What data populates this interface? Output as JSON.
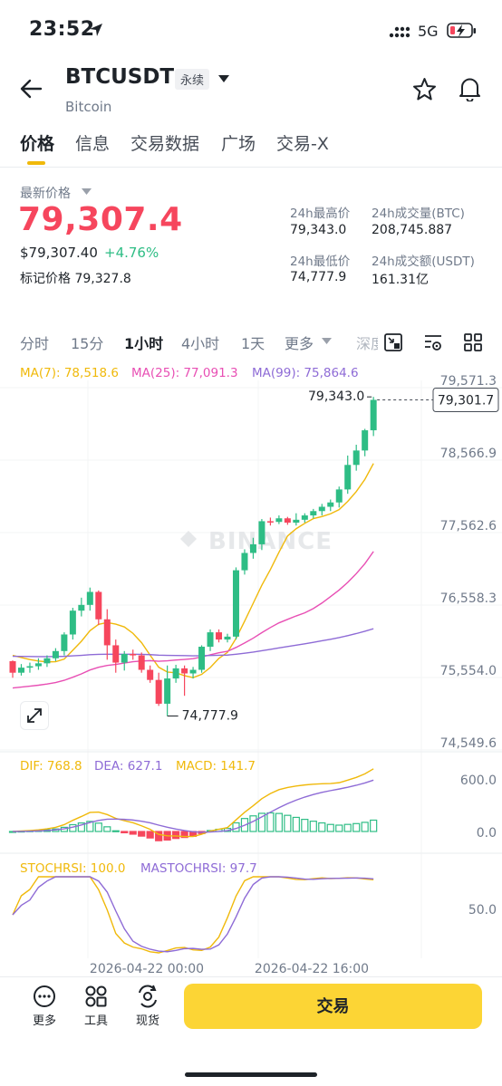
{
  "status_bar": {
    "time": "23:52",
    "network": "5G"
  },
  "header": {
    "symbol": "BTCUSDT",
    "contract_type": "永续",
    "name": "Bitcoin"
  },
  "tabs": [
    {
      "label": "价格",
      "active": true
    },
    {
      "label": "信息"
    },
    {
      "label": "交易数据"
    },
    {
      "label": "广场"
    },
    {
      "label": "交易-X"
    }
  ],
  "price": {
    "latest_label": "最新价格",
    "last": "79,307.4",
    "usd": "$79,307.40",
    "change": "+4.76%",
    "mark_label": "标记价格",
    "mark": "79,327.8"
  },
  "stats": {
    "high_label": "24h最高价",
    "high": "79,343.0",
    "low_label": "24h最低价",
    "low": "74,777.9",
    "vol_btc_label": "24h成交量(BTC)",
    "vol_btc": "208,745.887",
    "vol_usdt_label": "24h成交额(USDT)",
    "vol_usdt": "161.31亿"
  },
  "intervals": [
    {
      "label": "分时"
    },
    {
      "label": "15分"
    },
    {
      "label": "1小时",
      "active": true
    },
    {
      "label": "4小时"
    },
    {
      "label": "1天"
    },
    {
      "label": "更多"
    },
    {
      "label": "深度"
    }
  ],
  "indicators": {
    "ma7": "MA(7): 78,518.6",
    "ma25": "MA(25): 77,091.3",
    "ma99": "MA(99): 75,864.6",
    "dif": "DIF: 768.8",
    "dea": "DEA: 627.1",
    "macd": "MACD: 141.7",
    "stochrsi": "STOCHRSI: 100.0",
    "mastochrsi": "MASTOCHRSI: 97.7"
  },
  "chart_data": {
    "type": "candlestick",
    "price_ticks": [
      "79,571.3",
      "78,566.9",
      "77,562.6",
      "76,558.3",
      "75,554.0",
      "74,549.6"
    ],
    "current_price_tag": "79,301.7",
    "high_marker": "79,343.0",
    "low_marker": "74,777.9",
    "x_labels": [
      "2026-04-22 00:00",
      "2026-04-22 16:00"
    ],
    "macd_ticks": [
      "600.0",
      "0.0"
    ],
    "stoch_ticks": [
      "50.0"
    ],
    "watermark": "BINANCE",
    "colors": {
      "up": "#2ebd85",
      "down": "#f6465d",
      "ma7": "#f0b90b",
      "ma25": "#e84fb4",
      "ma99": "#8e6bd6"
    },
    "candles": [
      [
        75680,
        75690,
        75450,
        75520
      ],
      [
        75520,
        75640,
        75480,
        75590
      ],
      [
        75590,
        75660,
        75520,
        75610
      ],
      [
        75610,
        75720,
        75560,
        75650
      ],
      [
        75650,
        75760,
        75600,
        75720
      ],
      [
        75720,
        75860,
        75680,
        75820
      ],
      [
        75820,
        76080,
        75760,
        76050
      ],
      [
        76050,
        76420,
        75980,
        76380
      ],
      [
        76380,
        76560,
        76300,
        76460
      ],
      [
        76460,
        76700,
        76380,
        76640
      ],
      [
        76640,
        76660,
        76180,
        76260
      ],
      [
        76260,
        76400,
        75700,
        75900
      ],
      [
        75900,
        75980,
        75520,
        75660
      ],
      [
        75660,
        75820,
        75550,
        75780
      ],
      [
        75780,
        75840,
        75700,
        75760
      ],
      [
        75760,
        75800,
        75520,
        75560
      ],
      [
        75560,
        75620,
        75380,
        75420
      ],
      [
        75420,
        75520,
        75060,
        75090
      ],
      [
        75090,
        75620,
        74920,
        75440
      ],
      [
        75440,
        75630,
        75380,
        75580
      ],
      [
        75580,
        75620,
        75200,
        75510
      ],
      [
        75510,
        75600,
        75440,
        75560
      ],
      [
        75560,
        75900,
        75520,
        75880
      ],
      [
        75880,
        76120,
        75820,
        76080
      ],
      [
        76080,
        76120,
        75940,
        75980
      ],
      [
        75980,
        76060,
        75940,
        76020
      ],
      [
        76020,
        76980,
        75980,
        76940
      ],
      [
        76940,
        77230,
        76880,
        77180
      ],
      [
        77180,
        77390,
        77100,
        77300
      ],
      [
        77300,
        77650,
        77220,
        77620
      ],
      [
        77620,
        77670,
        77560,
        77610
      ],
      [
        77610,
        77700,
        77580,
        77660
      ],
      [
        77660,
        77680,
        77570,
        77600
      ],
      [
        77600,
        77730,
        77560,
        77640
      ],
      [
        77640,
        77730,
        77600,
        77700
      ],
      [
        77700,
        77790,
        77660,
        77760
      ],
      [
        77760,
        77860,
        77700,
        77820
      ],
      [
        77820,
        77920,
        77760,
        77880
      ],
      [
        77880,
        78100,
        77810,
        78060
      ],
      [
        78060,
        78530,
        78000,
        78400
      ],
      [
        78400,
        78680,
        78320,
        78600
      ],
      [
        78600,
        78900,
        78520,
        78880
      ],
      [
        78880,
        79343,
        78800,
        79301.7
      ]
    ]
  }
}
